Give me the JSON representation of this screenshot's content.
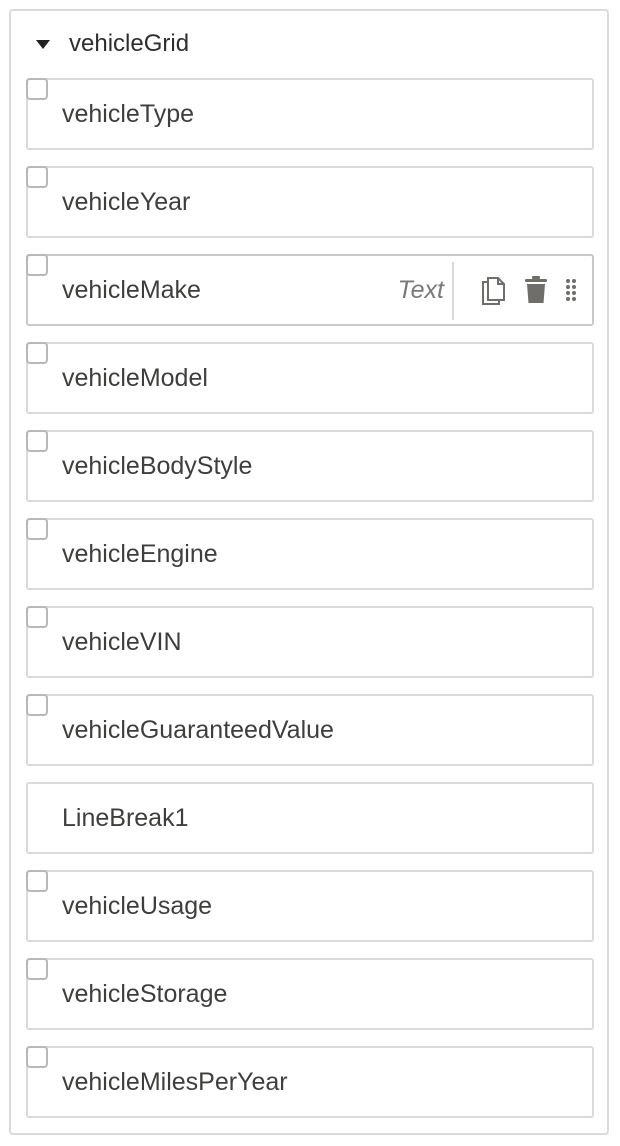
{
  "group": {
    "title": "vehicleGrid",
    "icon": "caret-down-icon"
  },
  "fields": [
    {
      "label": "vehicleType",
      "checkbox": true
    },
    {
      "label": "vehicleYear",
      "checkbox": true
    },
    {
      "label": "vehicleMake",
      "checkbox": true,
      "selected": true,
      "type_label": "Text",
      "actions": [
        "copy-icon",
        "trash-icon",
        "drag-handle-icon"
      ]
    },
    {
      "label": "vehicleModel",
      "checkbox": true
    },
    {
      "label": "vehicleBodyStyle",
      "checkbox": true
    },
    {
      "label": "vehicleEngine",
      "checkbox": true
    },
    {
      "label": "vehicleVIN",
      "checkbox": true
    },
    {
      "label": "vehicleGuaranteedValue",
      "checkbox": true
    },
    {
      "label": "LineBreak1",
      "checkbox": false
    },
    {
      "label": "vehicleUsage",
      "checkbox": true
    },
    {
      "label": "vehicleStorage",
      "checkbox": true
    },
    {
      "label": "vehicleMilesPerYear",
      "checkbox": true
    }
  ],
  "colors": {
    "border": "#d8dadc",
    "text": "#3e3e3c",
    "muted": "#7a7a7a",
    "icon": "#706e6b"
  }
}
